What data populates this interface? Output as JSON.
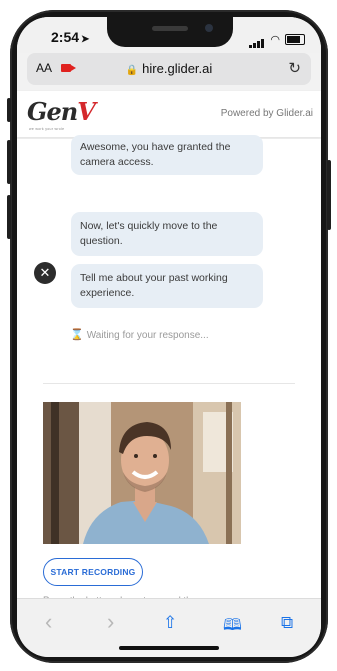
{
  "status_bar": {
    "time": "2:54",
    "location_arrow": "➤",
    "icons": [
      "signal-icon",
      "wifi-icon",
      "battery-icon"
    ]
  },
  "address_bar": {
    "text_size_label": "AA",
    "camera_indicator": "camera-in-use-icon",
    "lock_icon": "🔒",
    "url": "hire.glider.ai",
    "reload_icon": "↻"
  },
  "site_header": {
    "logo_text_main": "Gen",
    "logo_text_accent": "V",
    "logo_tagline": "we work your wrole",
    "powered_by": "Powered by Glider.ai"
  },
  "chat": {
    "messages": [
      {
        "text": "Awesome, you have granted the camera access."
      },
      {
        "text": "Now, let's quickly move to the question."
      },
      {
        "text": "Tell me about your past working experience."
      }
    ],
    "agent_avatar_icon": "chat-bot-avatar-icon",
    "waiting_icon": "⌛",
    "waiting_text": "Waiting for your response..."
  },
  "recording": {
    "video_preview": "camera-preview",
    "start_button": "START RECORDING",
    "hint": "Press the button above to record the answer."
  },
  "toolbar": {
    "back_icon": "‹",
    "forward_icon": "›",
    "share_icon": "⇧",
    "bookmarks_icon": "📖",
    "tabs_icon": "⧉"
  },
  "colors": {
    "accent": "#2a6cd6",
    "bubble_bg": "#e7eef5",
    "logo_red": "#d4282c"
  }
}
